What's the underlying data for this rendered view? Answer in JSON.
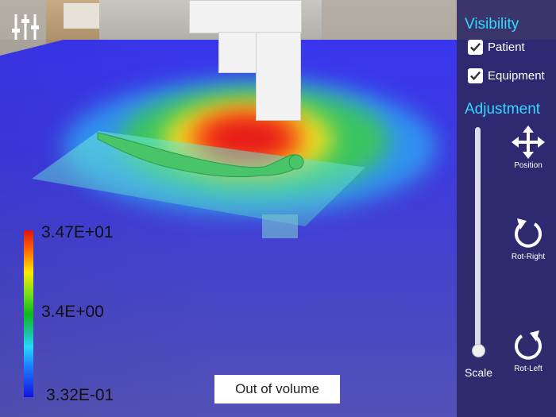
{
  "colorbar": {
    "max_label": "3.47E+01",
    "mid_label": "3.4E+00",
    "min_label": "3.32E-01",
    "colors": [
      "#e01313",
      "#ffe800",
      "#0fb81a",
      "#2ad8ff",
      "#1313e0"
    ]
  },
  "status_button": {
    "label": "Out of volume"
  },
  "panel": {
    "visibility_heading": "Visibility",
    "checkboxes": [
      {
        "label": "Patient",
        "checked": true
      },
      {
        "label": "Equipment",
        "checked": true
      }
    ],
    "adjustment_heading": "Adjustment",
    "scale_label": "Scale",
    "scale_value": 0.0,
    "tools": [
      {
        "label": "Position",
        "icon": "move-arrows-icon"
      },
      {
        "label": "Rot-Right",
        "icon": "rotate-right-icon"
      },
      {
        "label": "Rot-Left",
        "icon": "rotate-left-icon"
      }
    ],
    "heading_color": "#33d8ff",
    "background_color": "#2c2864"
  },
  "toolbar": {
    "filter_icon": "sliders-icon"
  }
}
